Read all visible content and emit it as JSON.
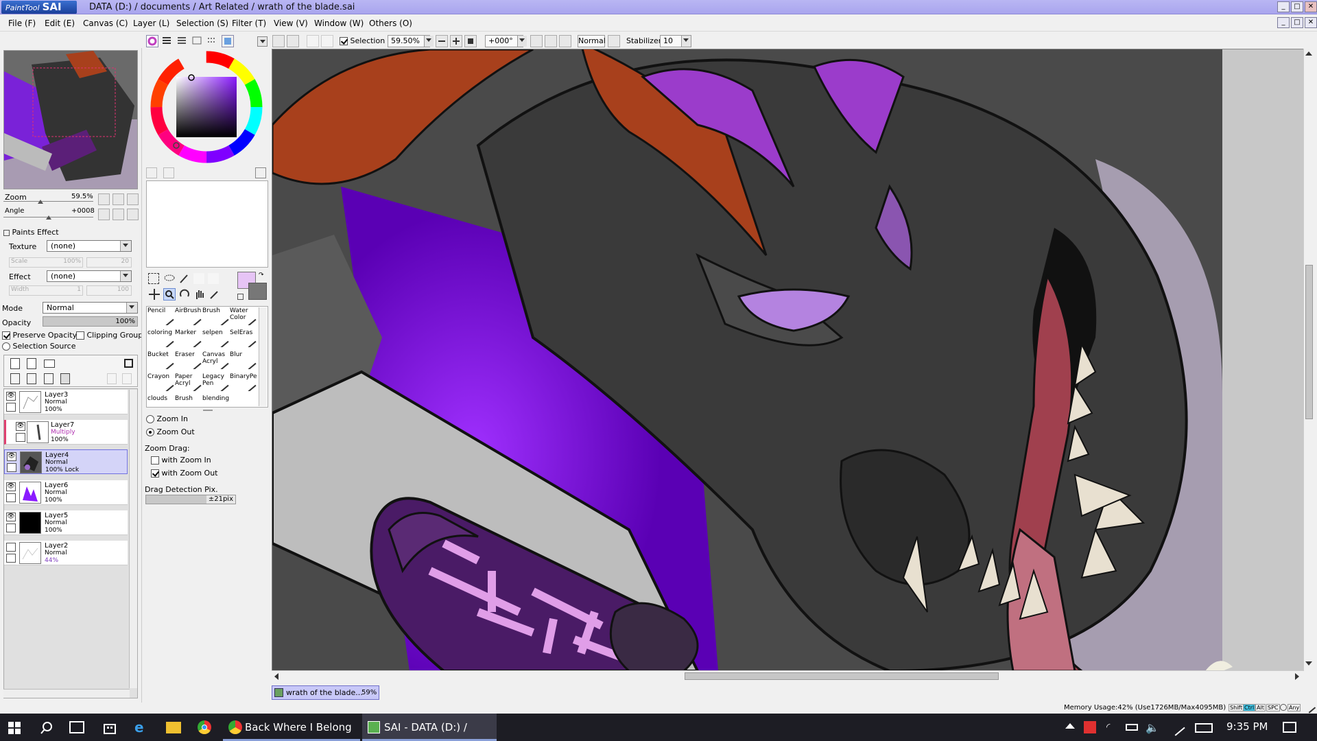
{
  "app": {
    "logo_prefix": "PaintTool",
    "logo_name": "SAI",
    "title": "DATA (D:) / documents / Art Related / wrath of the blade.sai"
  },
  "menu": [
    "File (F)",
    "Edit (E)",
    "Canvas (C)",
    "Layer (L)",
    "Selection (S)",
    "Filter (T)",
    "View (V)",
    "Window (W)",
    "Others (O)"
  ],
  "toolbar": {
    "selection_label": "Selection",
    "selection_checked": true,
    "zoom_value": "59.50%",
    "angle_value": "+000°",
    "blend_mode": "Normal",
    "stabilizer_label": "Stabilizer",
    "stabilizer_value": "10"
  },
  "navigator": {
    "zoom_label": "Zoom",
    "zoom_value": "59.5%",
    "angle_label": "Angle",
    "angle_value": "+0008"
  },
  "paints_effect": {
    "header": "Paints Effect",
    "texture_label": "Texture",
    "texture_value": "(none)",
    "scale_label": "Scale",
    "scale_value": "100%",
    "scale_num": "20",
    "effect_label": "Effect",
    "effect_value": "(none)",
    "width_label": "Width",
    "width_value": "1",
    "width_num": "100"
  },
  "layer_props": {
    "mode_label": "Mode",
    "mode_value": "Normal",
    "opacity_label": "Opacity",
    "opacity_value": "100%",
    "preserve_opacity": "Preserve Opacity",
    "clipping_group": "Clipping Group",
    "selection_source": "Selection Source"
  },
  "layers": [
    {
      "name": "Layer3",
      "mode": "Normal",
      "opacity": "100%",
      "visible": true
    },
    {
      "name": "Layer7",
      "mode": "Multiply",
      "opacity": "100%",
      "visible": true
    },
    {
      "name": "Layer4",
      "mode": "Normal",
      "opacity": "100% Lock",
      "visible": true,
      "selected": true
    },
    {
      "name": "Layer6",
      "mode": "Normal",
      "opacity": "100%",
      "visible": true
    },
    {
      "name": "Layer5",
      "mode": "Normal",
      "opacity": "100%",
      "visible": true
    },
    {
      "name": "Layer2",
      "mode": "Normal",
      "opacity": "44%",
      "visible": false
    }
  ],
  "tools": [
    "Pencil",
    "AirBrush",
    "Brush",
    "Water Color",
    "coloring",
    "Marker",
    "selpen",
    "SelEras",
    "Bucket",
    "Eraser",
    "Canvas Acryl",
    "Blur",
    "Crayon",
    "Paper Acryl",
    "Legacy Pen",
    "BinaryPe",
    "clouds",
    "Brush",
    "blending",
    ""
  ],
  "zoom_options": {
    "zoom_in": "Zoom In",
    "zoom_out": "Zoom Out",
    "zoom_drag_label": "Zoom Drag:",
    "with_zoom_in": "with Zoom In",
    "with_zoom_out": "with Zoom Out",
    "drag_detection_label": "Drag Detection Pix.",
    "drag_detection_value": "±21pix"
  },
  "doc_tab": {
    "name": "wrath of the blade...",
    "zoom": "59%"
  },
  "status": {
    "memory": "Memory Usage:42% (Use1726MB/Max4095MB)",
    "keys": [
      "Shift",
      "Ctrl",
      "Alt",
      "SPC",
      "Any"
    ]
  },
  "colors": {
    "primary": "#e6c4f5",
    "secondary": "#777777",
    "titlebar": "#b0acf0",
    "accent": "#8a1aff"
  },
  "taskbar": {
    "task1": "Back Where I Belong -...",
    "task2": "SAI - DATA (D:) / doc...",
    "time": "9:35 PM"
  }
}
